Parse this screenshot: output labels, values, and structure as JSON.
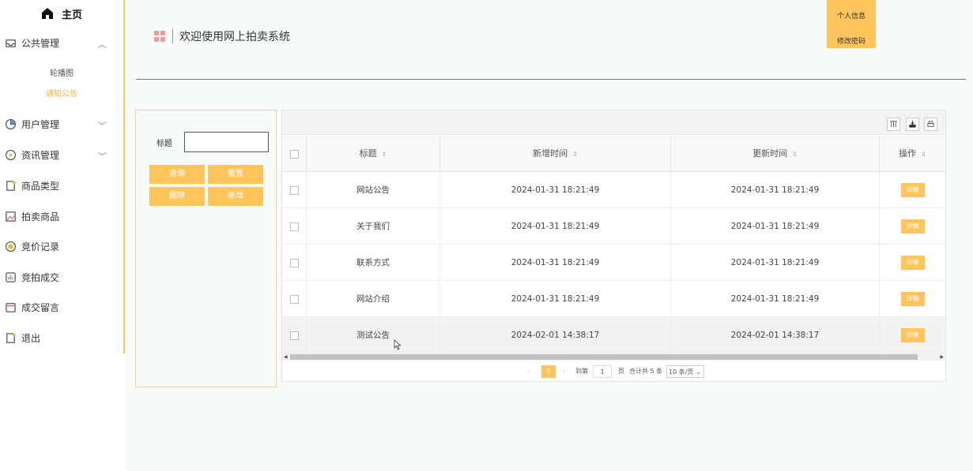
{
  "sidebar": {
    "home_label": "主页",
    "items": [
      {
        "label": "公共管理",
        "icon": "inbox-icon"
      },
      {
        "label": "用户管理",
        "icon": "pie-chart-icon"
      },
      {
        "label": "资讯管理",
        "icon": "info-circle-icon"
      },
      {
        "label": "商品类型",
        "icon": "document-icon"
      },
      {
        "label": "拍卖商品",
        "icon": "image-icon"
      },
      {
        "label": "竞价记录",
        "icon": "coin-icon"
      },
      {
        "label": "竞拍成交",
        "icon": "bar-chart-icon"
      },
      {
        "label": "成交留言",
        "icon": "calendar-icon"
      },
      {
        "label": "退出",
        "icon": "document-icon"
      }
    ],
    "submenu": [
      {
        "label": "轮播图"
      },
      {
        "label": "通知公告",
        "active": true
      }
    ]
  },
  "header": {
    "title": "欢迎使用网上拍卖系统",
    "user_menu": [
      "个人信息",
      "修改密码"
    ]
  },
  "search": {
    "title_label": "标题",
    "title_value": "",
    "buttons": {
      "query": "查询",
      "reset": "重置",
      "delete": "删除",
      "add": "新增"
    }
  },
  "table": {
    "columns": [
      "标题",
      "新增时间",
      "更新时间",
      "操作"
    ],
    "rows": [
      {
        "title": "网站公告",
        "created": "2024-01-31 18:21:49",
        "updated": "2024-01-31 18:21:49",
        "action": "详情"
      },
      {
        "title": "关于我们",
        "created": "2024-01-31 18:21:49",
        "updated": "2024-01-31 18:21:49",
        "action": "详情"
      },
      {
        "title": "联系方式",
        "created": "2024-01-31 18:21:49",
        "updated": "2024-01-31 18:21:49",
        "action": "详情"
      },
      {
        "title": "网站介绍",
        "created": "2024-01-31 18:21:49",
        "updated": "2024-01-31 18:21:49",
        "action": "详情"
      },
      {
        "title": "测试公告",
        "created": "2024-02-01 14:38:17",
        "updated": "2024-02-01 14:38:17",
        "action": "详情"
      }
    ]
  },
  "pagination": {
    "current_page": "1",
    "goto_prefix": "到第",
    "goto_value": "1",
    "page_suffix": "页",
    "total": "合计共 5 条",
    "page_size": "10 条/页"
  },
  "colors": {
    "accent": "#ffc55c",
    "active_text": "#f5b338",
    "grid_icon": "#f29a8e"
  }
}
